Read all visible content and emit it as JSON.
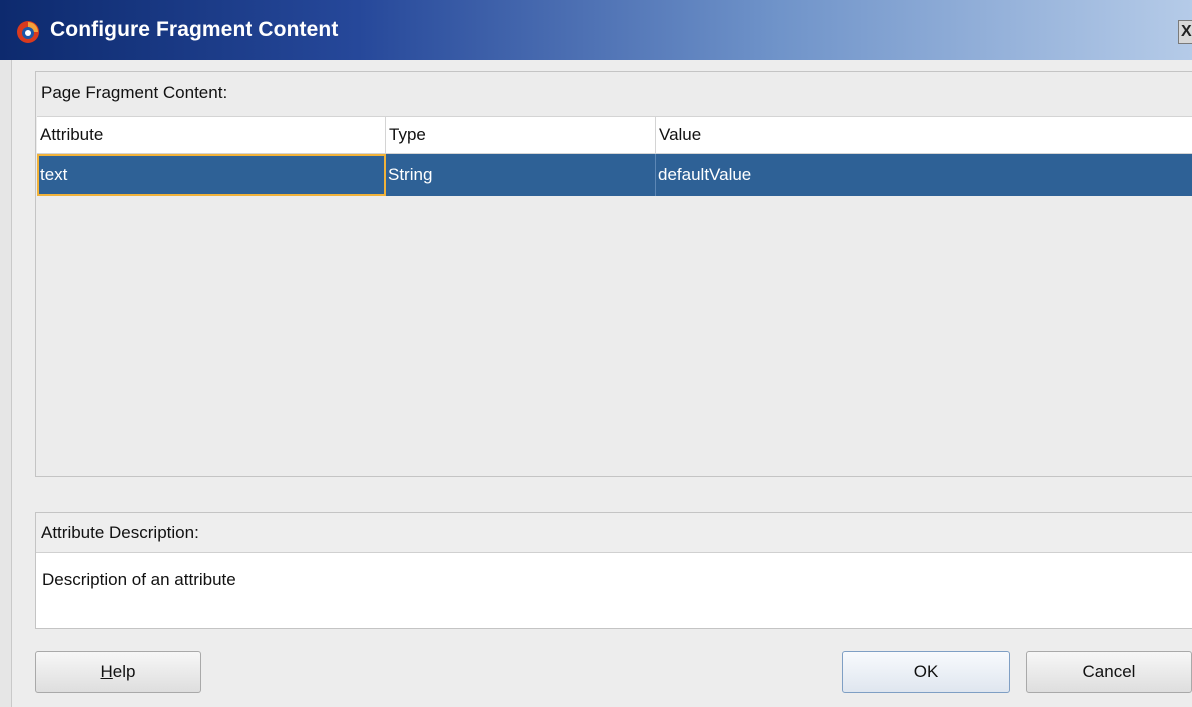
{
  "window": {
    "title": "Configure Fragment Content",
    "close_glyph": "X"
  },
  "fragment_panel": {
    "title": "Page Fragment Content:",
    "columns": [
      "Attribute",
      "Type",
      "Value"
    ],
    "rows": [
      {
        "attribute": "text",
        "type": "String",
        "value": "defaultValue",
        "selected": true
      }
    ]
  },
  "description_panel": {
    "title": "Attribute Description:",
    "text": "Description of an attribute"
  },
  "buttons": {
    "help_mnemonic": "H",
    "help_rest": "elp",
    "ok": "OK",
    "cancel": "Cancel"
  },
  "colors": {
    "selection": "#2e6196",
    "focus_border": "#f0b23a",
    "title_gradient_start": "#0d2a6e",
    "title_gradient_end": "#b5cbe8"
  },
  "icons": {
    "app_icon": "oracle-jdeveloper-icon",
    "close_icon": "close-icon"
  }
}
